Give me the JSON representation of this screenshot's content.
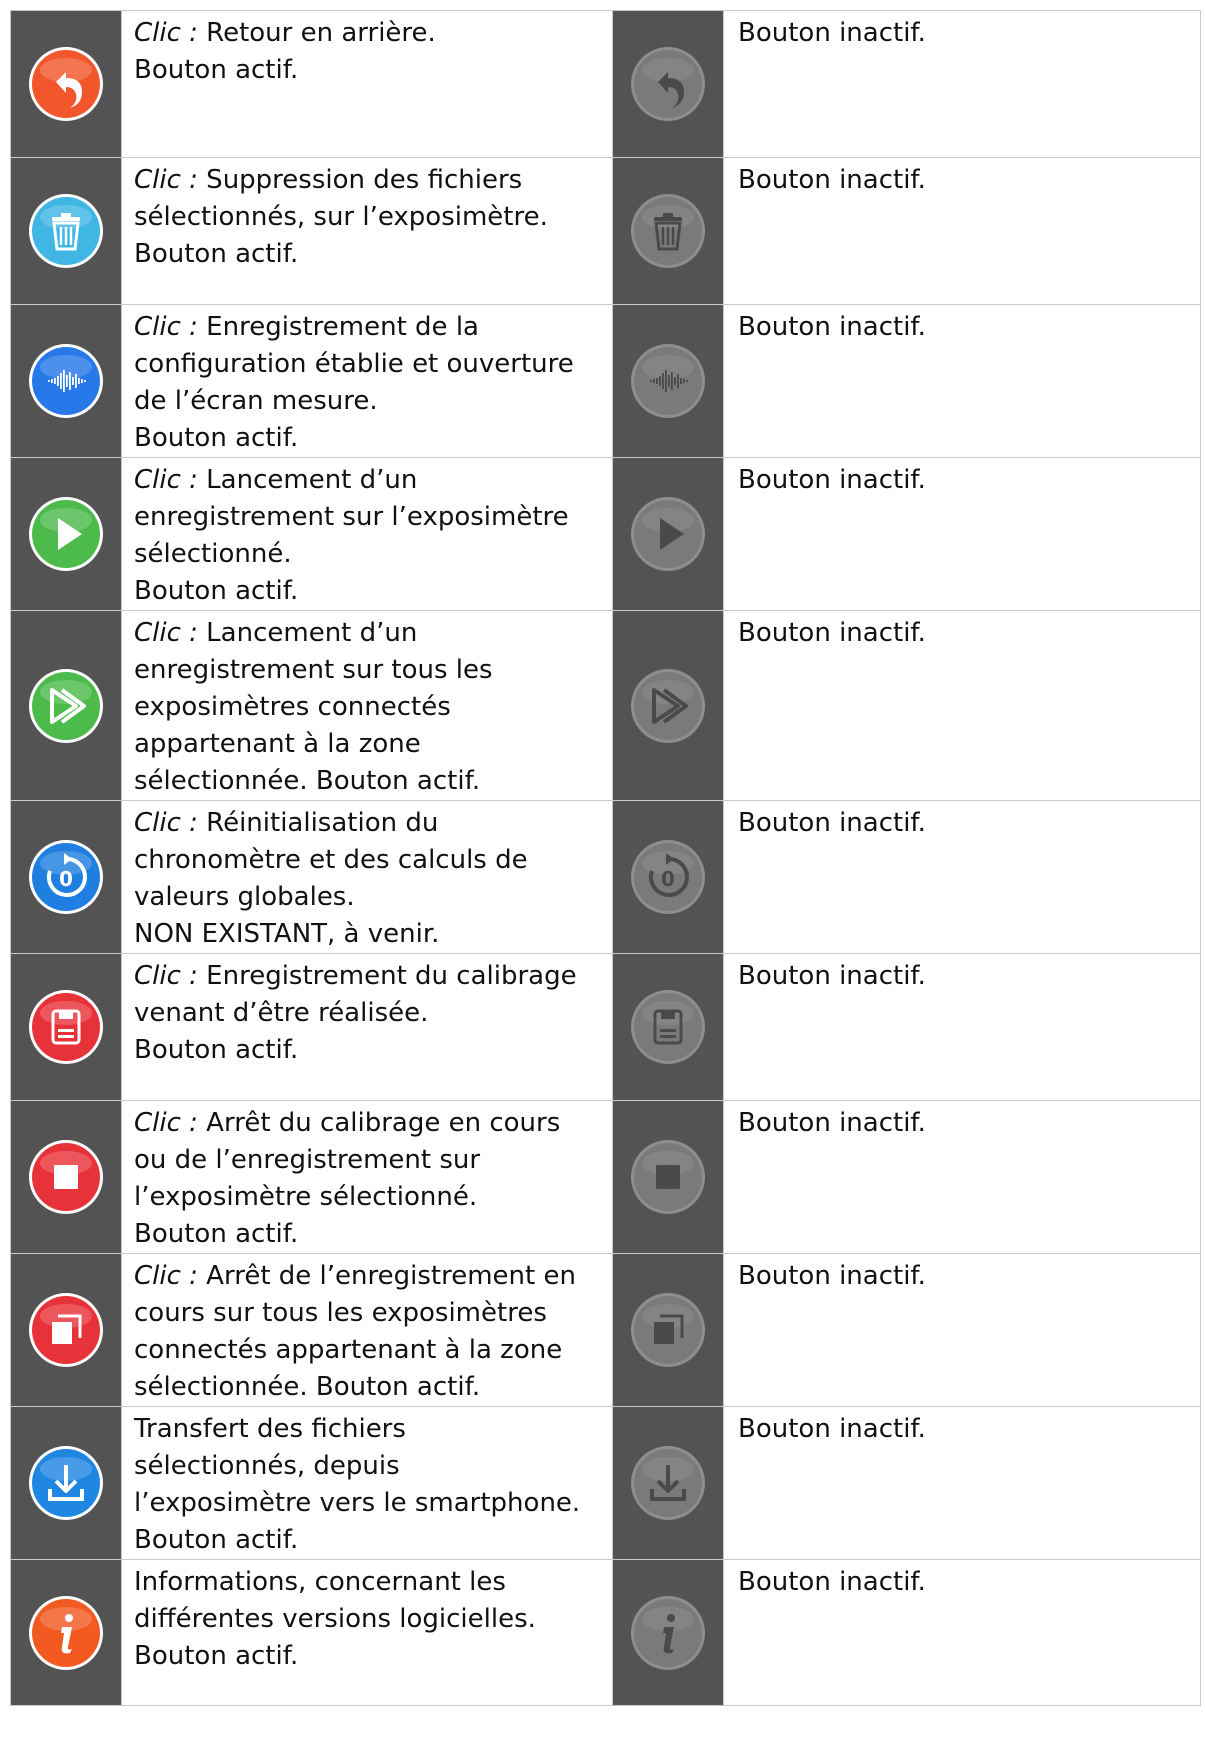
{
  "colors": {
    "icon_column_bg": "#535353",
    "back": "#f2572c",
    "delete": "#3fb6e4",
    "measure": "#2778e8",
    "play": "#4cbb4c",
    "play_all": "#4cbb4c",
    "reset": "#1f7fe0",
    "save": "#e8323a",
    "stop": "#e8323a",
    "stop_all": "#e8323a",
    "download": "#1f86e2",
    "info": "#f25a22",
    "inactive": "#7a7a7a"
  },
  "rows": [
    {
      "icon": "back-arrow-icon",
      "lines": [
        {
          "prefix": "Clic :",
          "text": " Retour en arrière."
        },
        {
          "prefix": "",
          "text": "Bouton actif."
        }
      ],
      "inactive_text": "Bouton inactif."
    },
    {
      "icon": "trash-icon",
      "lines": [
        {
          "prefix": "Clic :",
          "text": " Suppression des fichiers"
        },
        {
          "prefix": "",
          "text": "sélectionnés, sur l’exposimètre."
        },
        {
          "prefix": "",
          "text": "Bouton actif."
        }
      ],
      "inactive_text": "Bouton inactif."
    },
    {
      "icon": "sound-wave-icon",
      "lines": [
        {
          "prefix": "Clic :",
          "text": " Enregistrement de la"
        },
        {
          "prefix": "",
          "text": "configuration établie et ouverture"
        },
        {
          "prefix": "",
          "text": "de l’écran mesure."
        },
        {
          "prefix": "",
          "text": "Bouton actif."
        }
      ],
      "inactive_text": "Bouton inactif."
    },
    {
      "icon": "play-icon",
      "lines": [
        {
          "prefix": "Clic :",
          "text": " Lancement d’un"
        },
        {
          "prefix": "",
          "text": "enregistrement sur l’exposimètre"
        },
        {
          "prefix": "",
          "text": "sélectionné."
        },
        {
          "prefix": "",
          "text": "Bouton actif."
        }
      ],
      "inactive_text": "Bouton inactif."
    },
    {
      "icon": "play-all-icon",
      "lines": [
        {
          "prefix": "Clic :",
          "text": " Lancement d’un"
        },
        {
          "prefix": "",
          "text": "enregistrement sur tous les"
        },
        {
          "prefix": "",
          "text": "exposimètres connectés"
        },
        {
          "prefix": "",
          "text": "appartenant à la zone"
        },
        {
          "prefix": "",
          "text": "sélectionnée. Bouton actif."
        }
      ],
      "inactive_text": "Bouton inactif."
    },
    {
      "icon": "reset-zero-icon",
      "lines": [
        {
          "prefix": "Clic :",
          "text": " Réinitialisation du"
        },
        {
          "prefix": "",
          "text": "chronomètre et des calculs de"
        },
        {
          "prefix": "",
          "text": "valeurs globales."
        },
        {
          "prefix": "",
          "text": "NON EXISTANT, à venir."
        }
      ],
      "inactive_text": "Bouton inactif."
    },
    {
      "icon": "save-icon",
      "lines": [
        {
          "prefix": "Clic :",
          "text": " Enregistrement du calibrage"
        },
        {
          "prefix": "",
          "text": "venant d’être réalisée."
        },
        {
          "prefix": "",
          "text": "Bouton actif."
        }
      ],
      "inactive_text": "Bouton inactif."
    },
    {
      "icon": "stop-icon",
      "lines": [
        {
          "prefix": "Clic :",
          "text": " Arrêt du calibrage en cours"
        },
        {
          "prefix": "",
          "text": "ou de l’enregistrement sur"
        },
        {
          "prefix": "",
          "text": "l’exposimètre sélectionné."
        },
        {
          "prefix": "",
          "text": "Bouton actif."
        }
      ],
      "inactive_text": "Bouton inactif."
    },
    {
      "icon": "stop-all-icon",
      "lines": [
        {
          "prefix": "Clic :",
          "text": " Arrêt de l’enregistrement en"
        },
        {
          "prefix": "",
          "text": "cours sur tous les exposimètres"
        },
        {
          "prefix": "",
          "text": "connectés appartenant à la zone"
        },
        {
          "prefix": "",
          "text": "sélectionnée. Bouton actif."
        }
      ],
      "inactive_text": "Bouton inactif."
    },
    {
      "icon": "download-icon",
      "lines": [
        {
          "prefix": "",
          "text": "Transfert des fichiers"
        },
        {
          "prefix": "",
          "text": "sélectionnés, depuis"
        },
        {
          "prefix": "",
          "text": "l’exposimètre vers le smartphone."
        },
        {
          "prefix": "",
          "text": "Bouton actif."
        }
      ],
      "inactive_text": "Bouton inactif."
    },
    {
      "icon": "info-icon",
      "lines": [
        {
          "prefix": "",
          "text": "Informations, concernant les"
        },
        {
          "prefix": "",
          "text": "différentes versions logicielles."
        },
        {
          "prefix": "",
          "text": "Bouton actif."
        }
      ],
      "inactive_text": "Bouton inactif."
    }
  ]
}
